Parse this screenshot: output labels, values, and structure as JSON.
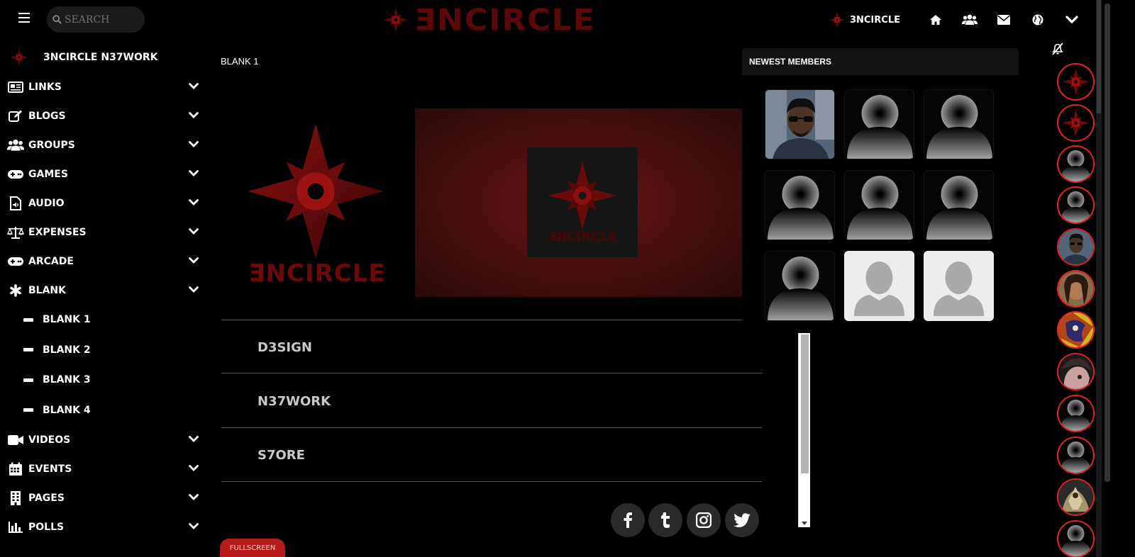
{
  "header": {
    "search_placeholder": "SEARCH",
    "brand_word": "ƎNCIRCLE",
    "site_name": "3NCIRCLE",
    "icons": [
      "home-icon",
      "users-icon",
      "envelope-icon",
      "globe-icon",
      "chevron-down-icon"
    ]
  },
  "sidebar": {
    "network_label": "3NCIRCLE N37WORK",
    "items": [
      {
        "label": "LINKS",
        "icon": "newspaper-icon"
      },
      {
        "label": "BLOGS",
        "icon": "edit-icon"
      },
      {
        "label": "GROUPS",
        "icon": "users-icon"
      },
      {
        "label": "GAMES",
        "icon": "gamepad-icon"
      },
      {
        "label": "AUDIO",
        "icon": "audio-file-icon"
      },
      {
        "label": "EXPENSES",
        "icon": "balance-scale-icon"
      },
      {
        "label": "ARCADE",
        "icon": "gamepad-icon"
      },
      {
        "label": "BLANK",
        "icon": "asterisk-icon"
      }
    ],
    "sub_items": [
      {
        "label": "BLANK 1"
      },
      {
        "label": "BLANK 2"
      },
      {
        "label": "BLANK 3"
      },
      {
        "label": "BLANK 4"
      }
    ],
    "items_after": [
      {
        "label": "VIDEOS",
        "icon": "video-icon"
      },
      {
        "label": "EVENTS",
        "icon": "calendar-icon"
      },
      {
        "label": "PAGES",
        "icon": "building-icon"
      },
      {
        "label": "POLLS",
        "icon": "bar-chart-icon"
      }
    ]
  },
  "main": {
    "breadcrumb": "BLANK 1",
    "logo_word": "ƎNCIRCLE",
    "sections": [
      {
        "label": "D3SIGN"
      },
      {
        "label": "N37WORK"
      },
      {
        "label": "S7ORE"
      }
    ],
    "social": [
      "facebook-icon",
      "tumblr-icon",
      "instagram-icon",
      "twitter-icon"
    ],
    "fullscreen_label": "FULLSCREEN"
  },
  "members": {
    "title": "NEWEST MEMBERS"
  },
  "colors": {
    "accent": "#e0242a",
    "logo_dark_red": "#5a0808",
    "background": "#000000"
  }
}
